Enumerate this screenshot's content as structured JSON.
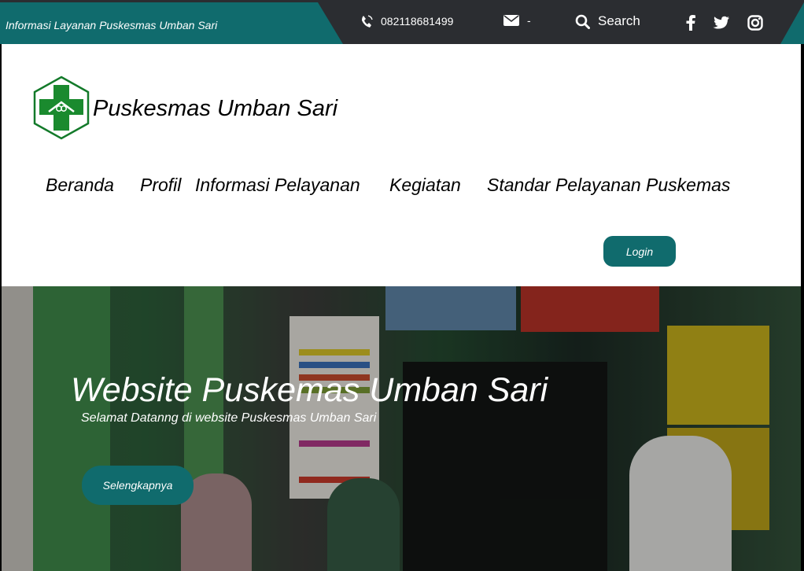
{
  "topbar": {
    "info_text": "Informasi Layanan Puskesmas Umban Sari",
    "phone": "082118681499",
    "email": "-",
    "search_label": "Search",
    "icons": [
      "phone-icon",
      "mail-icon",
      "search-icon",
      "facebook-icon",
      "twitter-icon",
      "instagram-icon"
    ]
  },
  "header": {
    "site_name": "Puskesmas Umban Sari",
    "logo": "puskesmas-logo",
    "nav": [
      "Beranda",
      "Profil",
      "Informasi Pelayanan",
      "Kegiatan",
      "Standar Pelayanan Puskemas"
    ],
    "login_label": "Login"
  },
  "hero": {
    "title": "Website Puskemas Umban Sari",
    "subtitle": "Selamat Datanng di website Puskesmas Umban Sari",
    "button_label": "Selengkapnya"
  },
  "colors": {
    "accent": "#106b6d",
    "topbar": "#2b2d31",
    "header_bg": "#ffffff",
    "logo_green": "#1a8a2e"
  }
}
